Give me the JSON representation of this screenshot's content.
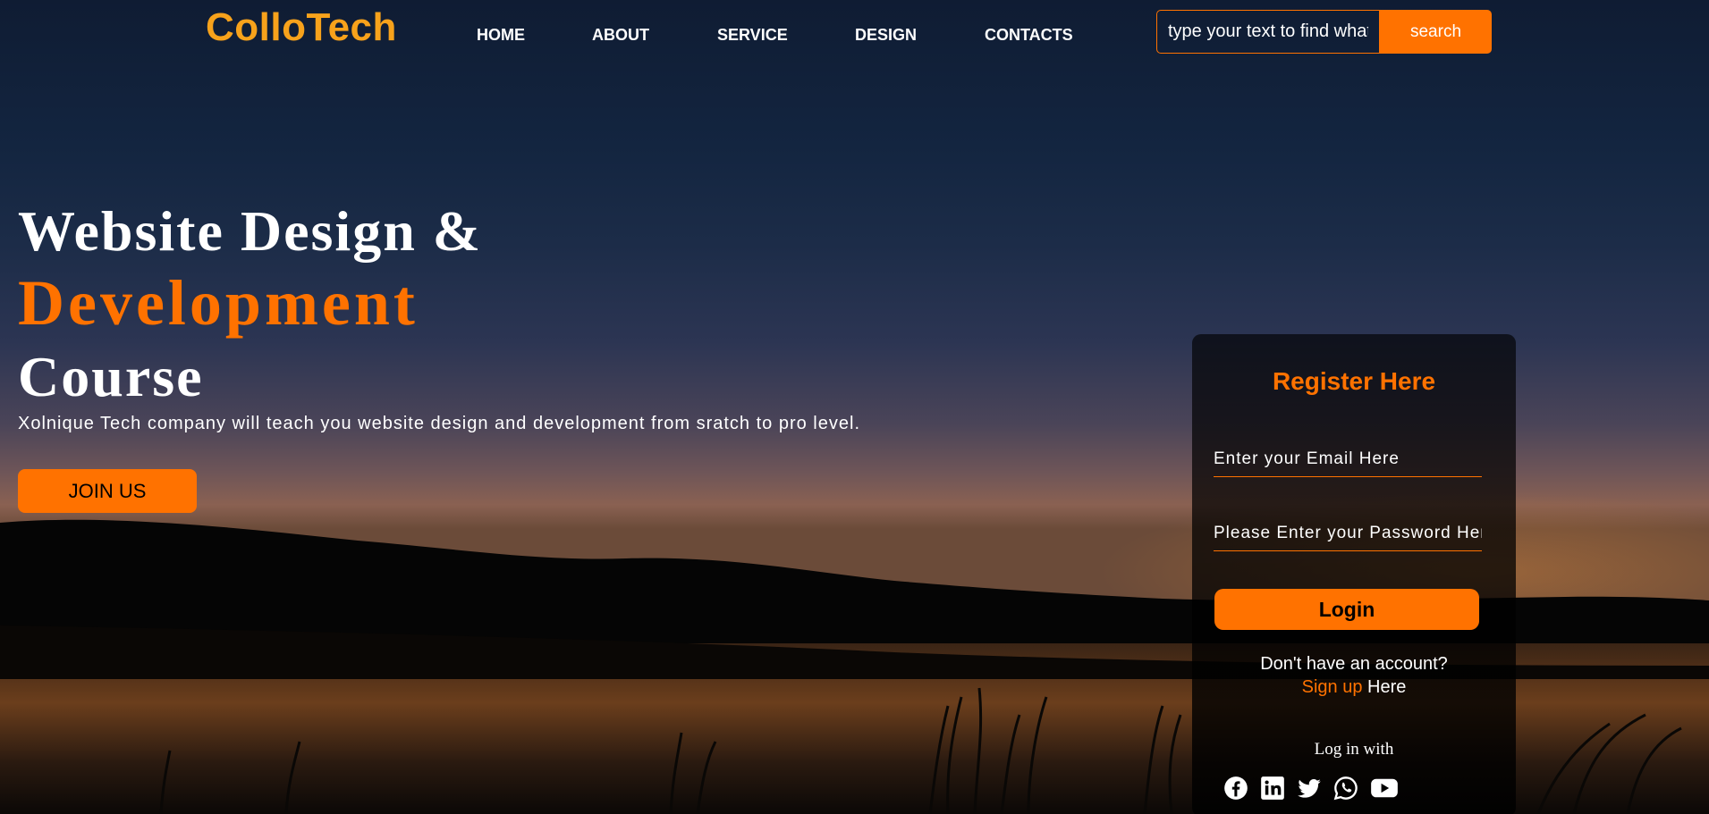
{
  "header": {
    "logo": "ColloTech",
    "nav": [
      "HOME",
      "ABOUT",
      "SERVICE",
      "DESIGN",
      "CONTACTS"
    ],
    "search": {
      "placeholder": "type your text to find what you want",
      "button_label": "search"
    }
  },
  "hero": {
    "line1": "Website Design &",
    "line2": "Development",
    "line3": "Course",
    "subtitle": "Xolnique Tech company will teach you website design and development from sratch to pro level.",
    "cta_label": "JOIN US"
  },
  "register": {
    "title": "Register Here",
    "email_placeholder": "Enter your Email Here",
    "password_placeholder": "Please Enter your Password Here",
    "login_label": "Login",
    "no_account": "Don't have an account?",
    "signup_link": "Sign up",
    "signup_suffix": " Here",
    "login_with": "Log in with",
    "social": [
      "facebook",
      "linkedin",
      "twitter",
      "whatsapp",
      "youtube"
    ]
  },
  "colors": {
    "accent": "#ff7200",
    "logo": "#f7a21b"
  }
}
